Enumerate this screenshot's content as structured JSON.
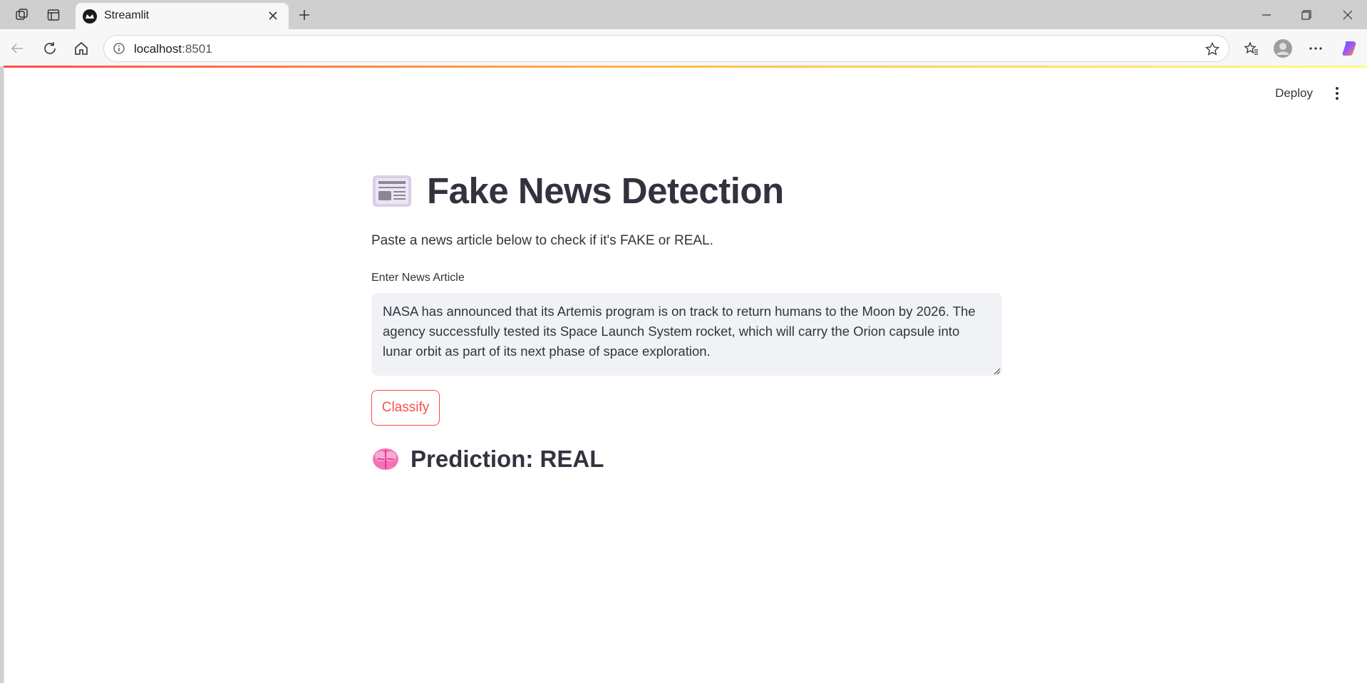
{
  "browser": {
    "tab_title": "Streamlit",
    "url_host": "localhost",
    "url_port": ":8501"
  },
  "header": {
    "deploy_label": "Deploy"
  },
  "main": {
    "title": "Fake News Detection",
    "subtitle": "Paste a news article below to check if it's FAKE or REAL.",
    "input_label": "Enter News Article",
    "input_value": "NASA has announced that its Artemis program is on track to return humans to the Moon by 2026. The agency successfully tested its Space Launch System rocket, which will carry the Orion capsule into lunar orbit as part of its next phase of space exploration.",
    "classify_label": "Classify",
    "prediction": "Prediction: REAL"
  },
  "icons": {
    "title_icon": "newspaper-icon",
    "prediction_icon": "brain-icon"
  },
  "colors": {
    "accent": "#ff4b4b",
    "text": "#31333f",
    "input_bg": "#f0f2f6"
  }
}
